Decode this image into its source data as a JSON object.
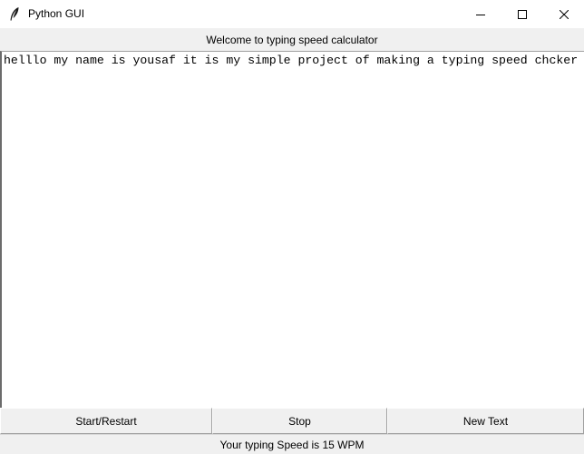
{
  "window": {
    "title": "Python GUI",
    "icon": "feather-icon",
    "controls": {
      "minimize_icon": "minimize-icon",
      "maximize_icon": "maximize-icon",
      "close_icon": "close-icon"
    }
  },
  "header": {
    "label": "Welcome to typing speed calculator"
  },
  "text_area": {
    "content": "helllo my name is yousaf it is my simple project of making a typing speed chcker"
  },
  "buttons": {
    "start": "Start/Restart",
    "stop": "Stop",
    "new_text": "New Text"
  },
  "status": {
    "text": "Your typing Speed is 15 WPM"
  }
}
